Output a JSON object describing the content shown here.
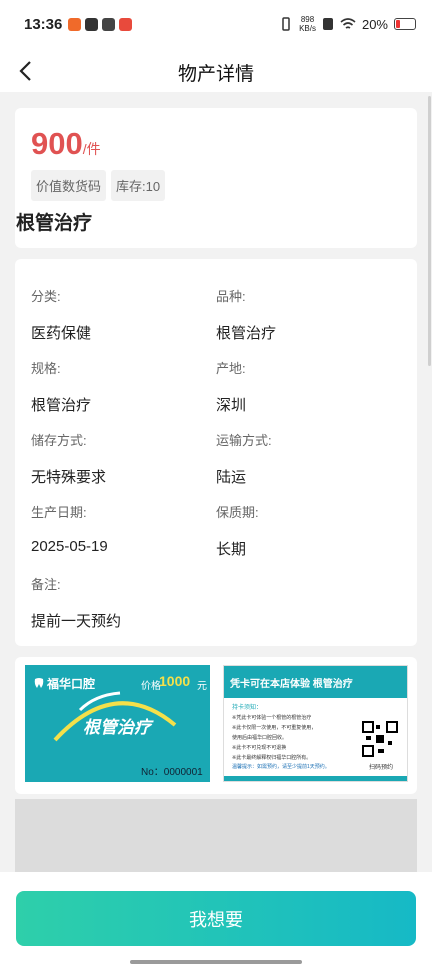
{
  "status_bar": {
    "time": "13:36",
    "speed_value": "898",
    "speed_unit": "KB/s",
    "battery": "20%"
  },
  "nav": {
    "title": "物产详情"
  },
  "product": {
    "price": "900",
    "unit": "/件",
    "tags": [
      "价值数货码",
      "库存:10"
    ],
    "name": "根管治疗"
  },
  "details": [
    {
      "label": "分类:",
      "value": "医药保健"
    },
    {
      "label": "品种:",
      "value": "根管治疗"
    },
    {
      "label": "规格:",
      "value": "根管治疗"
    },
    {
      "label": "产地:",
      "value": "深圳"
    },
    {
      "label": "储存方式:",
      "value": "无特殊要求"
    },
    {
      "label": "运输方式:",
      "value": "陆运"
    },
    {
      "label": "生产日期:",
      "value": "2025-05-19"
    },
    {
      "label": "保质期:",
      "value": "长期"
    },
    {
      "label": "备注:",
      "value": "提前一天预约"
    }
  ],
  "card_front": {
    "brand": "福华口腔",
    "price_label": "价格",
    "price_value": "1000",
    "price_unit": "元",
    "title": "根管治疗",
    "number": "No：0000001"
  },
  "card_back": {
    "heading": "凭卡可在本店体验 根管治疗",
    "notes_title": "持卡须知：",
    "lines": [
      "※凭此卡可体验一个根管的根管治疗",
      "※此卡仅限一次使用，不可重复使用，",
      "  使用后由福华口腔回收。",
      "※此卡不可兑现不可退换",
      "※此卡最终解释权归福华口腔所有。"
    ],
    "footer_note": "温馨提示：如需预约，请至少提前1天预约。",
    "scan_label": "扫码预约"
  },
  "action": {
    "cta_label": "我想要"
  },
  "colors": {
    "price": "#e05252",
    "cta_start": "#2ecfaa",
    "cta_end": "#16b9c6",
    "card_teal": "#1aa8b4"
  }
}
